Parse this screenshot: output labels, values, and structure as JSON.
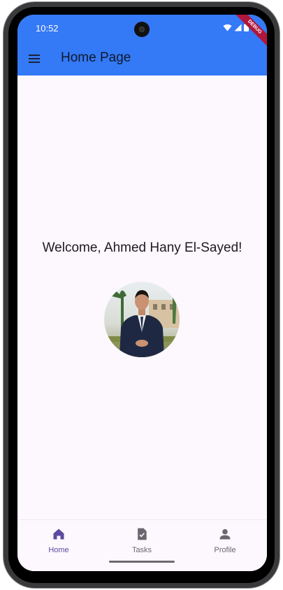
{
  "status_bar": {
    "time": "10:52",
    "icons": [
      "wifi-icon",
      "signal-icon",
      "battery-icon"
    ]
  },
  "app_bar": {
    "title": "Home Page",
    "menu_icon": "menu-icon",
    "color": "#3479f6"
  },
  "debug_banner": {
    "label": "DEBUG"
  },
  "main": {
    "welcome_text": "Welcome, Ahmed Hany El-Sayed!"
  },
  "bottom_nav": {
    "items": [
      {
        "label": "Home",
        "icon": "home-icon",
        "selected": true
      },
      {
        "label": "Tasks",
        "icon": "tasks-icon",
        "selected": false
      },
      {
        "label": "Profile",
        "icon": "profile-icon",
        "selected": false
      }
    ],
    "selected_color": "#5b4a9e",
    "unselected_color": "#6b6670"
  }
}
